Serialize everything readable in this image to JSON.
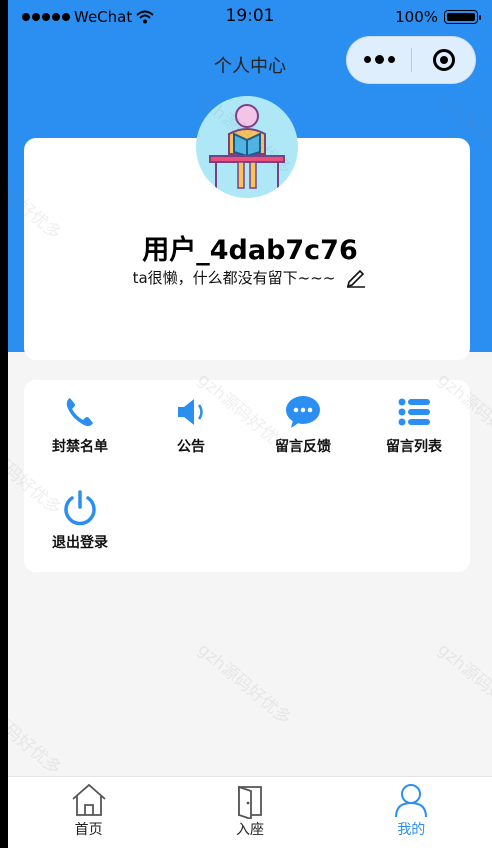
{
  "status_bar": {
    "carrier": "WeChat",
    "time": "19:01",
    "battery": "100%"
  },
  "nav": {
    "title": "个人中心"
  },
  "profile": {
    "username": "用户_4dab7c76",
    "bio": "ta很懒，什么都没有留下~~~"
  },
  "menu": [
    {
      "label": "封禁名单",
      "icon": "phone-icon"
    },
    {
      "label": "公告",
      "icon": "speaker-icon"
    },
    {
      "label": "留言反馈",
      "icon": "chat-bubble-icon"
    },
    {
      "label": "留言列表",
      "icon": "list-icon"
    },
    {
      "label": "退出登录",
      "icon": "power-icon"
    }
  ],
  "tabbar": [
    {
      "label": "首页",
      "icon": "home-icon",
      "active": false
    },
    {
      "label": "入座",
      "icon": "door-icon",
      "active": false
    },
    {
      "label": "我的",
      "icon": "user-icon",
      "active": true
    }
  ],
  "watermark": "gzh源码好优多",
  "colors": {
    "primary": "#2b8ff2",
    "background": "#f5f5f5"
  }
}
